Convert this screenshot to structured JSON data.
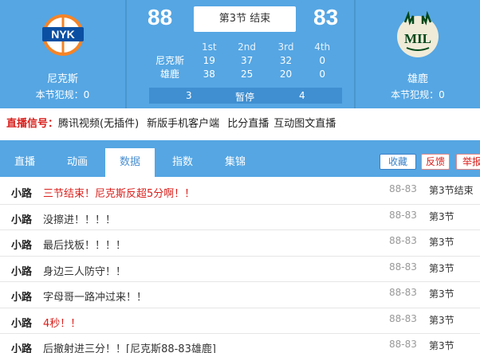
{
  "home": {
    "name": "尼克斯",
    "logo_text": "NYK",
    "fouls": "本节犯规：0",
    "score": "88"
  },
  "away": {
    "name": "雄鹿",
    "logo_text": "MIL",
    "fouls": "本节犯规：0",
    "score": "83"
  },
  "status": "第3节 结束",
  "quarters": {
    "headers": [
      "1st",
      "2nd",
      "3rd",
      "4th"
    ],
    "rows": [
      {
        "team": "尼克斯",
        "scores": [
          "19",
          "37",
          "32",
          "0"
        ]
      },
      {
        "team": "雄鹿",
        "scores": [
          "38",
          "25",
          "20",
          "0"
        ]
      }
    ]
  },
  "timeouts": {
    "home": "3",
    "label": "暂停",
    "away": "4"
  },
  "signal": {
    "label": "直播信号：",
    "links": [
      "腾讯视频(无插件)",
      "新版手机客户端",
      "比分直播",
      "互动图文直播"
    ]
  },
  "tabs": [
    "直播",
    "动画",
    "数据",
    "指数",
    "集锦"
  ],
  "buttons": {
    "fav": "收藏",
    "feedback": "反馈",
    "report": "举报"
  },
  "feed": [
    {
      "author": "小路",
      "text": "三节结束！尼克斯反超5分啊！！",
      "red": true,
      "score": "88-83",
      "quarter": "第3节结束"
    },
    {
      "author": "小路",
      "text": "没擦进！！！！",
      "red": false,
      "score": "88-83",
      "quarter": "第3节"
    },
    {
      "author": "小路",
      "text": "最后找板！！！！",
      "red": false,
      "score": "88-83",
      "quarter": "第3节"
    },
    {
      "author": "小路",
      "text": "身边三人防守！！",
      "red": false,
      "score": "88-83",
      "quarter": "第3节"
    },
    {
      "author": "小路",
      "text": "字母哥一路冲过来！！",
      "red": false,
      "score": "88-83",
      "quarter": "第3节"
    },
    {
      "author": "小路",
      "text": "4秒！！",
      "red": true,
      "score": "88-83",
      "quarter": "第3节"
    },
    {
      "author": "小路",
      "text": "后撤射进三分！！[尼克斯88-83雄鹿]",
      "red": false,
      "score": "88-83",
      "quarter": "第3节"
    }
  ],
  "colors": {
    "header_blue": "#55a6e3",
    "alert_red": "#d9201c",
    "knicks_orange": "#f58426",
    "bucks_green": "#00471b"
  }
}
